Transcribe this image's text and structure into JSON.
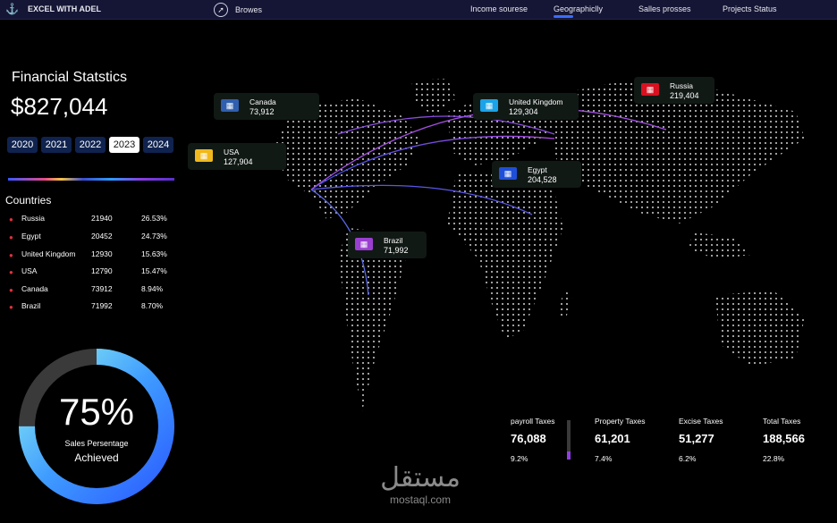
{
  "topbar": {
    "brand": "EXCEL WITH ADEL",
    "browse": "Browes",
    "nav": [
      "Income sourese",
      "Geographiclly",
      "Salles prosses",
      "Projects Status"
    ],
    "active_nav": "Geographiclly"
  },
  "summary": {
    "title": "Financial Statstics",
    "total": "$827,044",
    "years": [
      "2020",
      "2021",
      "2022",
      "2023",
      "2024"
    ],
    "selected_year": "2023"
  },
  "countries": {
    "title": "Countries",
    "rows": [
      {
        "name": "Russia",
        "value": "21940",
        "pct": "26.53%"
      },
      {
        "name": "Egypt",
        "value": "20452",
        "pct": "24.73%"
      },
      {
        "name": "United Kingdom",
        "value": "12930",
        "pct": "15.63%"
      },
      {
        "name": "USA",
        "value": "12790",
        "pct": "15.47%"
      },
      {
        "name": "Canada",
        "value": "73912",
        "pct": "8.94%"
      },
      {
        "name": "Brazil",
        "value": "71992",
        "pct": "8.70%"
      }
    ]
  },
  "map_cards": [
    {
      "name": "Canada",
      "value": "73,912",
      "color": "#2f5fae"
    },
    {
      "name": "USA",
      "value": "127,904",
      "color": "#f0b81c"
    },
    {
      "name": "United Kingdom",
      "value": "129,304",
      "color": "#1aa3e8"
    },
    {
      "name": "Russia",
      "value": "219,404",
      "color": "#d81020"
    },
    {
      "name": "Egypt",
      "value": "204,528",
      "color": "#1f4fd8"
    },
    {
      "name": "Brazil",
      "value": "71,992",
      "color": "#9a3fd0"
    }
  ],
  "gauge": {
    "percent_label": "75%",
    "value": 0.75,
    "label1": "Sales Persentage",
    "label2": "Achieved"
  },
  "taxes": [
    {
      "label": "payroll Taxes",
      "value": "76,088",
      "pct": "9.2%"
    },
    {
      "label": "Property Taxes",
      "value": "61,201",
      "pct": "7.4%"
    },
    {
      "label": "Excise Taxes",
      "value": "51,277",
      "pct": "6.2%"
    },
    {
      "label": "Total Taxes",
      "value": "188,566",
      "pct": "22.8%"
    }
  ],
  "watermark": {
    "arabic": "مستقل",
    "latin": "mostaql.com"
  },
  "colors": {
    "background": "#000000",
    "topbar": "#151535",
    "accent": "#3b6cff",
    "dot": "#e03040"
  }
}
